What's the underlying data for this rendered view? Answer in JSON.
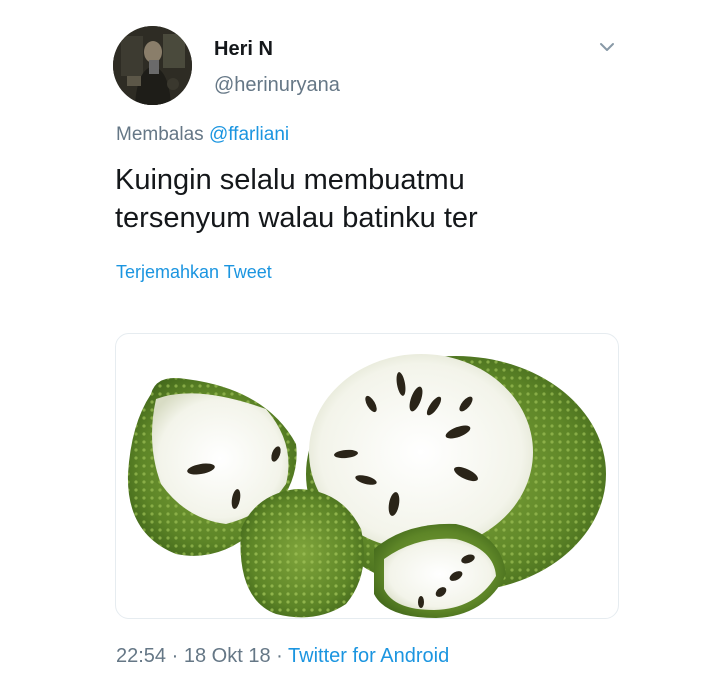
{
  "tweet": {
    "author_name": "Heri N",
    "author_handle": "@herinuryana",
    "reply_prefix": "Membalas",
    "reply_mention": "@ffarliani",
    "text_line1": "Kuingin selalu membuatmu",
    "text_line2": "tersenyum walau batinku ter",
    "translate_label": "Terjemahkan Tweet",
    "time": "22:54",
    "separator": "·",
    "date": "18 Okt 18",
    "source": "Twitter for Android"
  },
  "icons": {
    "menu": "chevron-down-icon"
  },
  "colors": {
    "link": "#1b95e0",
    "secondary_text": "#657786",
    "primary_text": "#14171a"
  }
}
